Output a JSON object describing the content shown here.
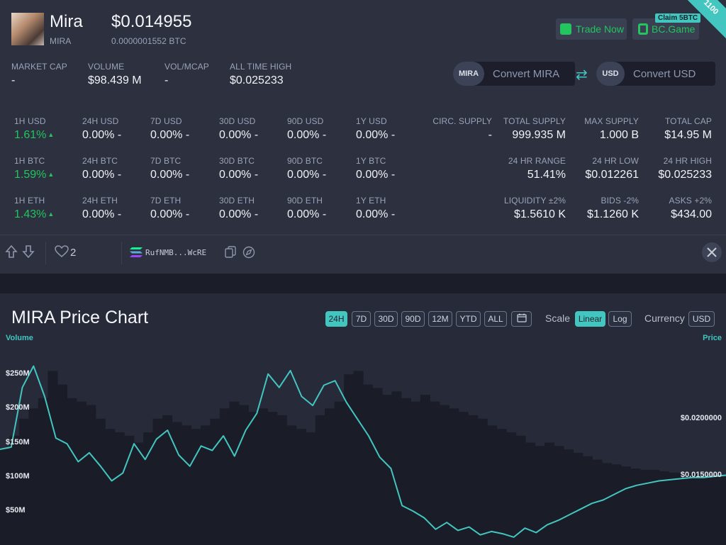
{
  "coin": {
    "name": "Mira",
    "symbol": "MIRA",
    "price_usd": "$0.014955",
    "price_btc": "0.0000001552 BTC"
  },
  "corner_badge": "1100",
  "actions": {
    "trade_label": "Trade Now",
    "bcgame_label": "BC.Game",
    "claim_badge": "Claim 5BTC"
  },
  "summary": {
    "market_cap_label": "MARKET CAP",
    "market_cap_value": "-",
    "volume_label": "VOLUME",
    "volume_value": "$98.439 M",
    "volmcap_label": "VOL/MCAP",
    "volmcap_value": "-",
    "ath_label": "ALL TIME HIGH",
    "ath_value": "$0.025233"
  },
  "converter": {
    "from_symbol": "MIRA",
    "from_placeholder": "Convert MIRA",
    "swap_icon": "swap-arrows",
    "to_symbol": "USD",
    "to_placeholder": "Convert USD"
  },
  "performance": {
    "usd": [
      {
        "label": "1H USD",
        "value": "1.61%",
        "up": true
      },
      {
        "label": "24H USD",
        "value": "0.00% -"
      },
      {
        "label": "7D USD",
        "value": "0.00% -"
      },
      {
        "label": "30D USD",
        "value": "0.00% -"
      },
      {
        "label": "90D USD",
        "value": "0.00% -"
      },
      {
        "label": "1Y USD",
        "value": "0.00% -"
      }
    ],
    "btc": [
      {
        "label": "1H BTC",
        "value": "1.59%",
        "up": true
      },
      {
        "label": "24H BTC",
        "value": "0.00% -"
      },
      {
        "label": "7D BTC",
        "value": "0.00% -"
      },
      {
        "label": "30D BTC",
        "value": "0.00% -"
      },
      {
        "label": "90D BTC",
        "value": "0.00% -"
      },
      {
        "label": "1Y BTC",
        "value": "0.00% -"
      }
    ],
    "eth": [
      {
        "label": "1H ETH",
        "value": "1.43%",
        "up": true
      },
      {
        "label": "24H ETH",
        "value": "0.00% -"
      },
      {
        "label": "7D ETH",
        "value": "0.00% -"
      },
      {
        "label": "30D ETH",
        "value": "0.00% -"
      },
      {
        "label": "90D ETH",
        "value": "0.00% -"
      },
      {
        "label": "1Y ETH",
        "value": "0.00% -"
      }
    ]
  },
  "stats": {
    "circ_supply_label": "CIRC. SUPPLY",
    "circ_supply_value": "-",
    "total_supply_label": "TOTAL SUPPLY",
    "total_supply_value": "999.935 M",
    "max_supply_label": "MAX SUPPLY",
    "max_supply_value": "1.000 B",
    "total_cap_label": "TOTAL CAP",
    "total_cap_value": "$14.95 M",
    "range_label": "24 HR RANGE",
    "range_value": "51.41%",
    "low_label": "24 HR LOW",
    "low_value": "$0.012261",
    "high_label": "24 HR HIGH",
    "high_value": "$0.025233",
    "liquidity_label": "LIQUIDITY ±2%",
    "liquidity_value": "$1.5610 K",
    "bids_label": "BIDS -2%",
    "bids_value": "$1.1260 K",
    "asks_label": "ASKS +2%",
    "asks_value": "$434.00"
  },
  "toolbar": {
    "like_count": "2",
    "contract_short": "RufNMB...WcRE",
    "icons": [
      "upvote-icon",
      "downvote-icon",
      "heart-icon",
      "solana-icon",
      "copy-icon",
      "explorer-icon",
      "x-social-icon"
    ]
  },
  "chart_section": {
    "title": "MIRA Price Chart",
    "ranges": [
      "24H",
      "7D",
      "30D",
      "90D",
      "12M",
      "YTD",
      "ALL"
    ],
    "active_range": "24H",
    "scale_label": "Scale",
    "scale_options": [
      "Linear",
      "Log"
    ],
    "active_scale": "Linear",
    "currency_label": "Currency",
    "currency_value": "USD",
    "accent_color": "#43c6c0",
    "up_color": "#22c55e"
  },
  "chart_data": {
    "type": "line",
    "title": "MIRA Price Chart",
    "left_axis_label": "Volume",
    "right_axis_label": "Price",
    "volume_ticks": [
      "$250M",
      "$200M",
      "$150M",
      "$100M",
      "$50M"
    ],
    "volume_tick_values": [
      250,
      200,
      150,
      100,
      50
    ],
    "price_ticks": [
      "$0.0200000",
      "$0.0150000"
    ],
    "price_tick_values": [
      0.02,
      0.015
    ],
    "volume_unit": "M USD",
    "volume": [
      140,
      160,
      185,
      200,
      215,
      255,
      235,
      215,
      210,
      205,
      185,
      170,
      165,
      160,
      150,
      165,
      185,
      190,
      180,
      175,
      170,
      175,
      185,
      200,
      210,
      205,
      195,
      200,
      195,
      190,
      175,
      170,
      165,
      190,
      200,
      210,
      250,
      255,
      235,
      230,
      220,
      225,
      215,
      210,
      220,
      210,
      205,
      200,
      195,
      190,
      185,
      175,
      170,
      165,
      160,
      150,
      145,
      150,
      145,
      140,
      135,
      130,
      125,
      120,
      118,
      115,
      112,
      110,
      110,
      108,
      106,
      105,
      104,
      102,
      101,
      100
    ],
    "price": [
      0.0173,
      0.0175,
      0.0228,
      0.0247,
      0.022,
      0.0183,
      0.0178,
      0.0162,
      0.017,
      0.0158,
      0.0145,
      0.0152,
      0.0178,
      0.0164,
      0.0182,
      0.019,
      0.0168,
      0.0158,
      0.0176,
      0.0172,
      0.0185,
      0.0167,
      0.019,
      0.0205,
      0.024,
      0.0228,
      0.0243,
      0.022,
      0.0212,
      0.023,
      0.0234,
      0.0215,
      0.02,
      0.0185,
      0.0166,
      0.0156,
      0.0123,
      0.0118,
      0.0112,
      0.0102,
      0.0108,
      0.0101,
      0.0104,
      0.0097,
      0.01,
      0.0098,
      0.0095,
      0.0103,
      0.0099,
      0.0106,
      0.011,
      0.0115,
      0.012,
      0.0125,
      0.0128,
      0.0133,
      0.0138,
      0.0141,
      0.0143,
      0.0145,
      0.0146,
      0.0147,
      0.0148,
      0.0148,
      0.0149,
      0.015
    ],
    "volume_ylim": [
      0,
      300
    ],
    "price_ylim": [
      0.0088,
      0.027
    ],
    "grid": false
  }
}
